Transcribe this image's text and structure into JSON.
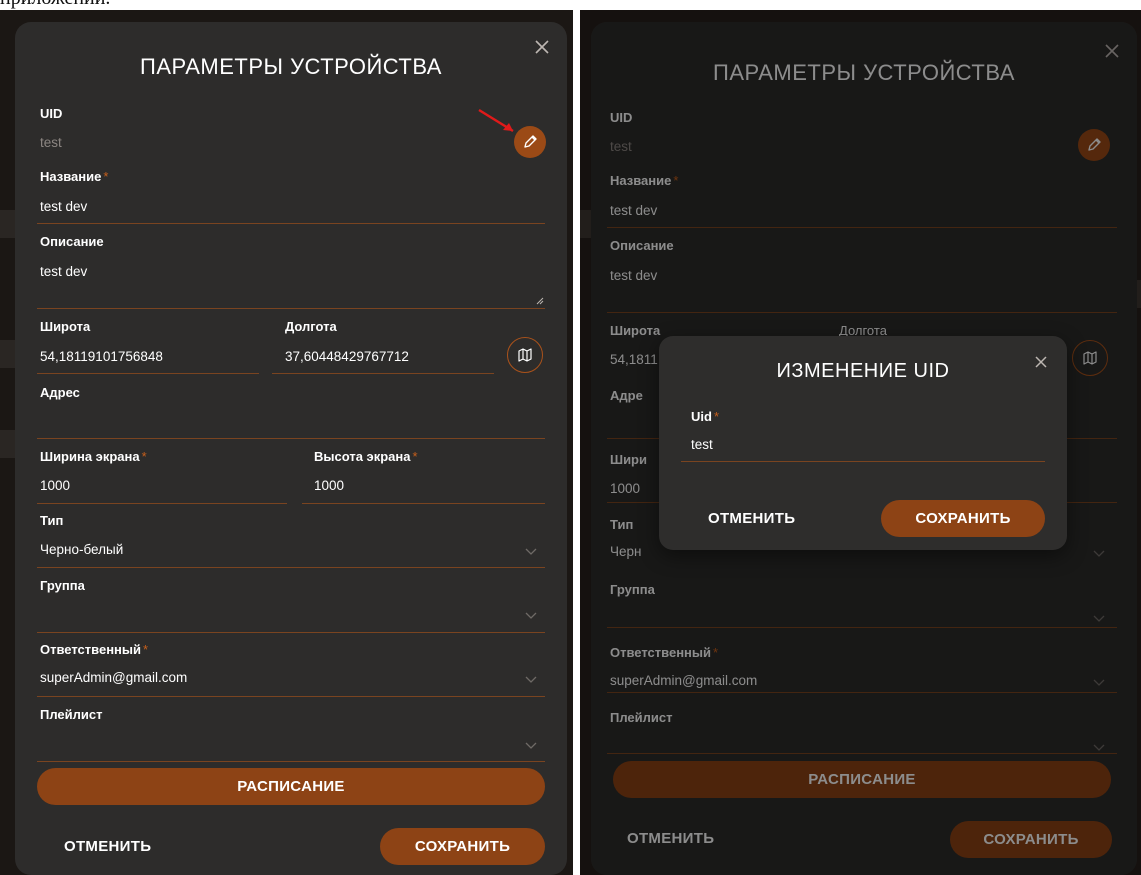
{
  "caption": "приложений.",
  "form": {
    "title": "ПАРАМЕТРЫ УСТРОЙСТВА",
    "uid": {
      "label": "UID",
      "value": "test"
    },
    "name": {
      "label": "Название",
      "value": "test dev"
    },
    "description": {
      "label": "Описание",
      "value": "test dev"
    },
    "latitude": {
      "label": "Широта",
      "value": "54,18119101756848"
    },
    "longitude": {
      "label": "Долгота",
      "value": "37,60448429767712"
    },
    "address": {
      "label": "Адрес",
      "value": ""
    },
    "screen_width": {
      "label": "Ширина экрана",
      "value": "1000"
    },
    "screen_height": {
      "label": "Высота экрана",
      "value": "1000"
    },
    "type": {
      "label": "Тип",
      "value": "Черно-белый"
    },
    "group": {
      "label": "Группа",
      "value": ""
    },
    "responsible": {
      "label": "Ответственный",
      "value": "superAdmin@gmail.com"
    },
    "playlist": {
      "label": "Плейлист",
      "value": ""
    },
    "schedule_button": "РАСПИСАНИЕ",
    "cancel_button": "ОТМЕНИТЬ",
    "save_button": "СОХРАНИТЬ",
    "required_mark": "*",
    "truncated": {
      "latitude": "54,1811",
      "address": "Адре",
      "screen_width": "Шири",
      "type_label": "Тип",
      "type_value": "Черн"
    }
  },
  "uid_dialog": {
    "title": "ИЗМЕНЕНИЕ UID",
    "field_label": "Uid",
    "field_value": "test",
    "cancel_button": "ОТМЕНИТЬ",
    "save_button": "СОХРАНИТЬ"
  },
  "colors": {
    "accent": "#8d4315",
    "required": "#c8601c",
    "modal_bg": "#2d2c2b",
    "annotation_arrow": "#e01a1a"
  }
}
